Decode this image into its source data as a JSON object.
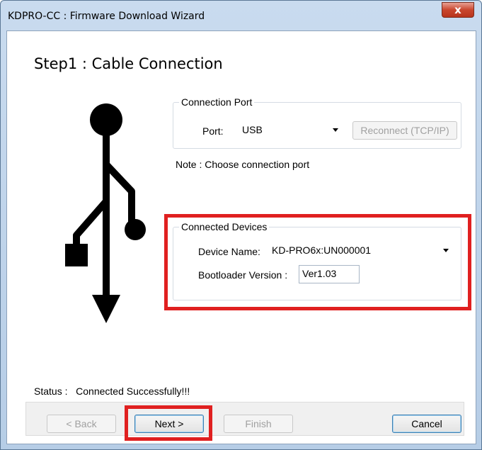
{
  "window": {
    "title": "KDPRO-CC : Firmware Download Wizard",
    "close_label": "x"
  },
  "step_title": "Step1 : Cable Connection",
  "connection_port": {
    "legend": "Connection Port",
    "port_label": "Port:",
    "port_value": "USB",
    "reconnect_label": "Reconnect (TCP/IP)"
  },
  "note": "Note : Choose connection port",
  "connected_devices": {
    "legend": "Connected Devices",
    "device_name_label": "Device Name:",
    "device_name_value": "KD-PRO6x:UN000001",
    "bootloader_label": "Bootloader Version :",
    "bootloader_value": "Ver1.03"
  },
  "status": {
    "label": "Status :",
    "value": "Connected Successfully!!!"
  },
  "buttons": {
    "back": "< Back",
    "next": "Next >",
    "finish": "Finish",
    "cancel": "Cancel"
  },
  "colors": {
    "highlight": "#e02020",
    "title_bar": "#c9dbef",
    "close_button": "#c9462d"
  },
  "icons": {
    "usb": "usb-icon"
  }
}
